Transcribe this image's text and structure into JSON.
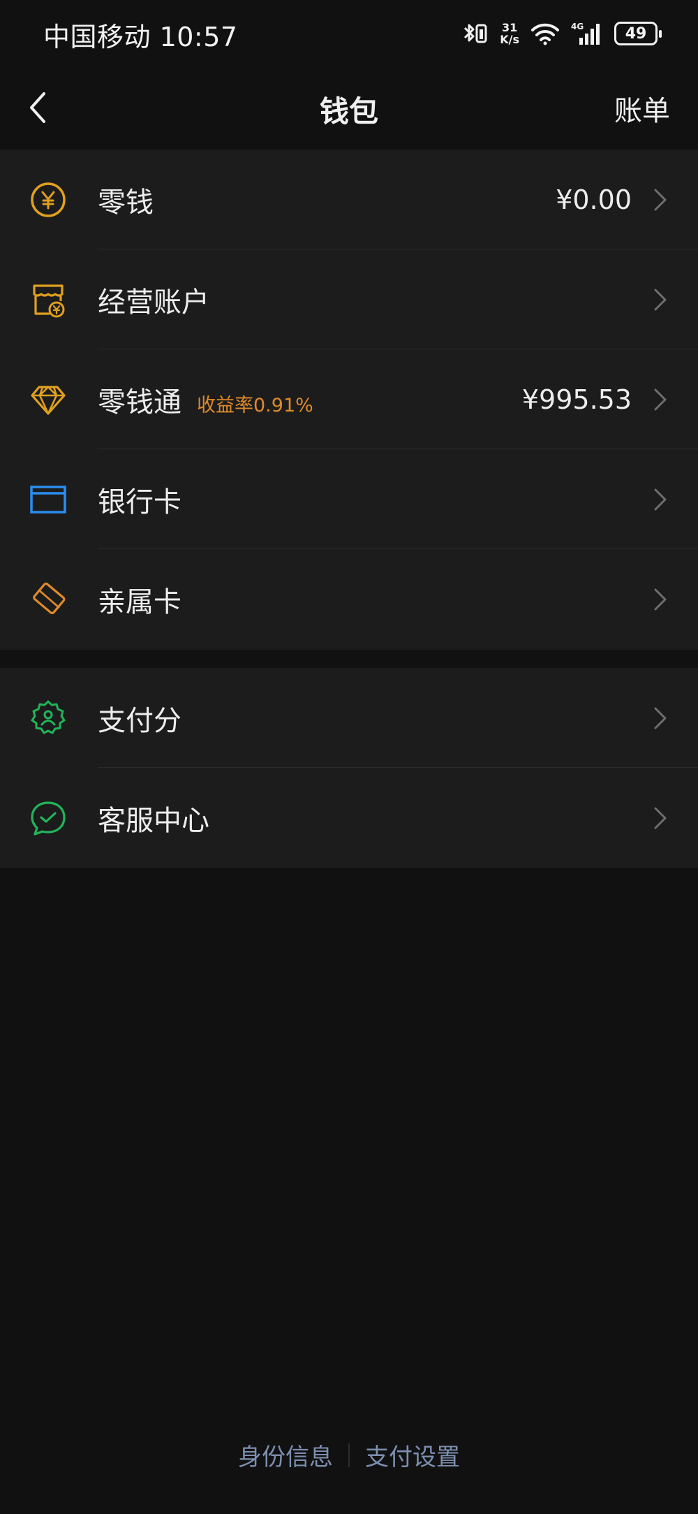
{
  "status_bar": {
    "carrier_time": "中国移动 10:57",
    "net_speed_value": "31",
    "net_speed_unit": "K/s",
    "network": "4G",
    "battery": "49"
  },
  "nav": {
    "title": "钱包",
    "bill_label": "账单"
  },
  "group1": {
    "items": [
      {
        "label": "零钱",
        "value": "¥0.00",
        "icon": "yuan-coin-icon",
        "color": "#e0a020"
      },
      {
        "label": "经营账户",
        "value": "",
        "icon": "shop-account-icon",
        "color": "#e0a020"
      },
      {
        "label": "零钱通",
        "tag": "收益率0.91%",
        "value": "¥995.53",
        "icon": "diamond-icon",
        "color": "#e0a020"
      },
      {
        "label": "银行卡",
        "value": "",
        "icon": "bank-card-icon",
        "color": "#2b8df0"
      },
      {
        "label": "亲属卡",
        "value": "",
        "icon": "family-card-icon",
        "color": "#e08a2a"
      }
    ]
  },
  "group2": {
    "items": [
      {
        "label": "支付分",
        "icon": "pay-score-icon",
        "color": "#22b45a"
      },
      {
        "label": "客服中心",
        "icon": "customer-service-icon",
        "color": "#22b45a"
      }
    ]
  },
  "footer": {
    "identity_label": "身份信息",
    "pay_settings_label": "支付设置"
  }
}
